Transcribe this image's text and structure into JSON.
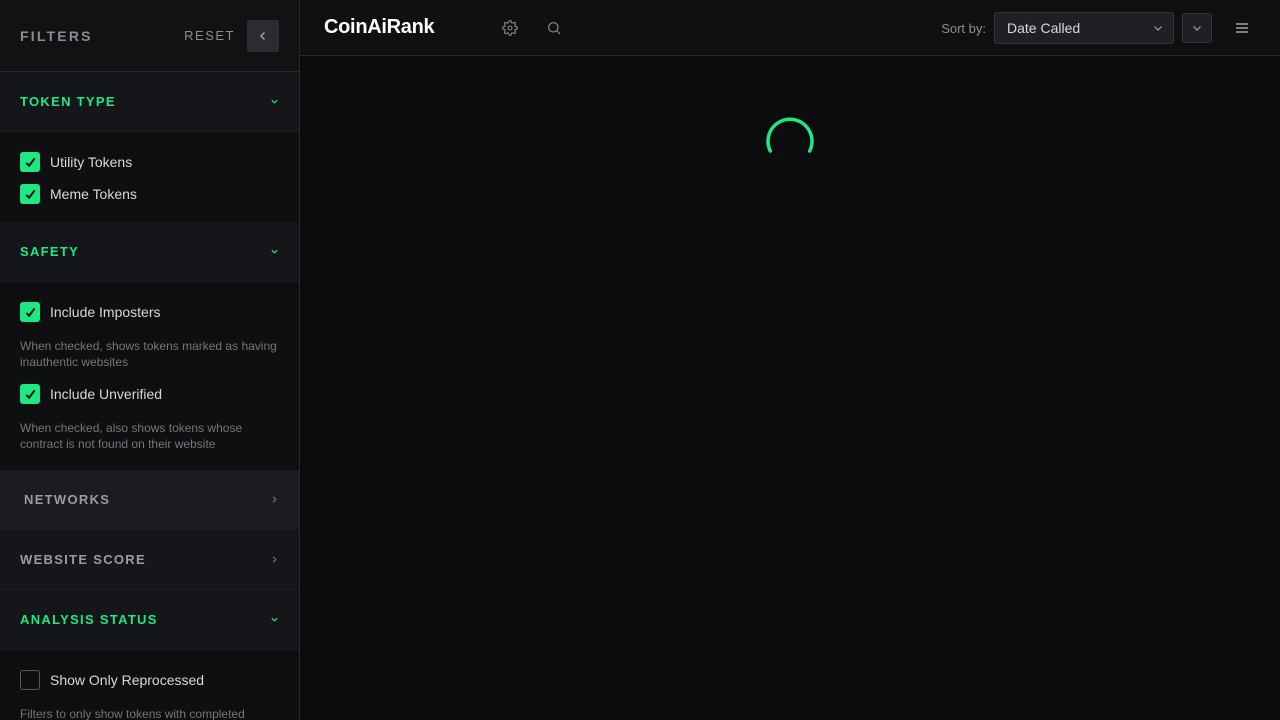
{
  "sidebar": {
    "title": "FILTERS",
    "reset_label": "RESET",
    "token_type": {
      "label": "TOKEN TYPE",
      "options": [
        {
          "label": "Utility Tokens",
          "checked": true
        },
        {
          "label": "Meme Tokens",
          "checked": true
        }
      ]
    },
    "safety": {
      "label": "SAFETY",
      "imposters_label": "Include Imposters",
      "imposters_hint": "When checked, shows tokens marked as having inauthentic websites",
      "unverified_label": "Include Unverified",
      "unverified_hint": "When checked, also shows tokens whose contract is not found on their website"
    },
    "networks": {
      "label": "NETWORKS"
    },
    "website_score": {
      "label": "WEBSITE SCORE"
    },
    "analysis_status": {
      "label": "ANALYSIS STATUS",
      "reprocessed_label": "Show Only Reprocessed",
      "reprocessed_hint": "Filters to only show tokens with completed"
    }
  },
  "header": {
    "brand": "CoinAiRank",
    "sort_label": "Sort by:",
    "sort_value": "Date Called"
  },
  "colors": {
    "accent": "#1de982",
    "background": "#0b0c0e",
    "sidebar": "#111214"
  },
  "icons": [
    "collapse-left-icon",
    "chevron-down-icon",
    "chevron-right-icon",
    "check-icon",
    "gear-icon",
    "search-icon",
    "menu-icon",
    "loading-spinner"
  ]
}
